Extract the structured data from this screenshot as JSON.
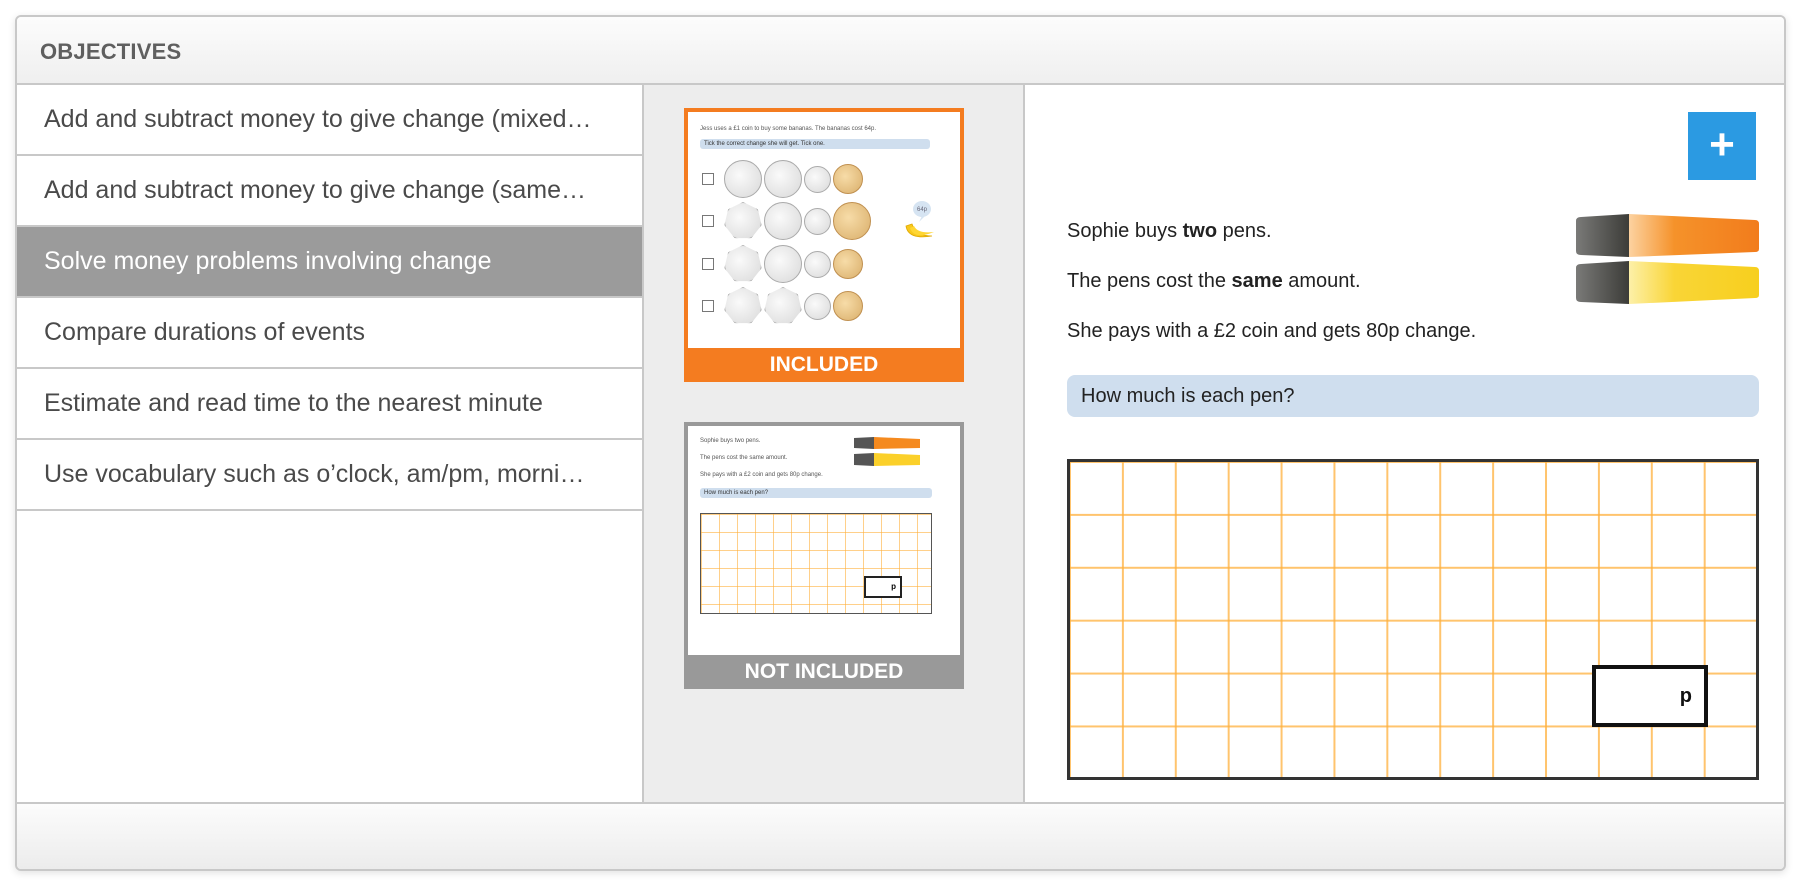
{
  "panel": {
    "title": "OBJECTIVES"
  },
  "objectives": {
    "items": [
      {
        "label": "Add and subtract money to give change (mixed…",
        "selected": false
      },
      {
        "label": "Add and subtract money to give change (same…",
        "selected": false
      },
      {
        "label": "Solve money problems involving change",
        "selected": true
      },
      {
        "label": "Compare durations of events",
        "selected": false
      },
      {
        "label": "Estimate and read time to the nearest minute",
        "selected": false
      },
      {
        "label": "Use vocabulary such as o’clock, am/pm, morni…",
        "selected": false
      }
    ]
  },
  "thumbnails": {
    "included": {
      "status_label": "INCLUDED",
      "intro": "Jess uses a £1 coin to buy some bananas. The bananas cost 64p.",
      "question": "Tick the correct change she will get. Tick one.",
      "price_tag": "64p",
      "coin_rows": [
        [
          "20p",
          "20p",
          "5p",
          "1p"
        ],
        [
          "50p",
          "20p",
          "5p",
          "2p"
        ],
        [
          "50p",
          "20p",
          "5p",
          "1p"
        ],
        [
          "50p",
          "50p",
          "5p",
          "1p"
        ]
      ]
    },
    "not_included": {
      "status_label": "NOT INCLUDED",
      "line1": "Sophie buys two pens.",
      "line2": "The pens cost the same amount.",
      "line3": "She pays with a £2 coin and gets 80p change.",
      "question": "How much is each pen?",
      "unit": "p"
    }
  },
  "preview": {
    "add_button_label": "+",
    "line1": {
      "pre": "Sophie buys ",
      "bold": "two",
      "post": " pens."
    },
    "line2": {
      "pre": "The pens cost the ",
      "bold": "same",
      "post": " amount."
    },
    "line3": "She pays with a £2 coin and gets 80p change.",
    "question": "How much is each pen?",
    "answer_unit": "p"
  },
  "colors": {
    "included": "#f47c20",
    "not_included": "#999999",
    "selected_item": "#9b9b9b",
    "add_button": "#2b9ae2",
    "question_bg": "#cfdeee",
    "grid_lines": "#ffb03c"
  }
}
